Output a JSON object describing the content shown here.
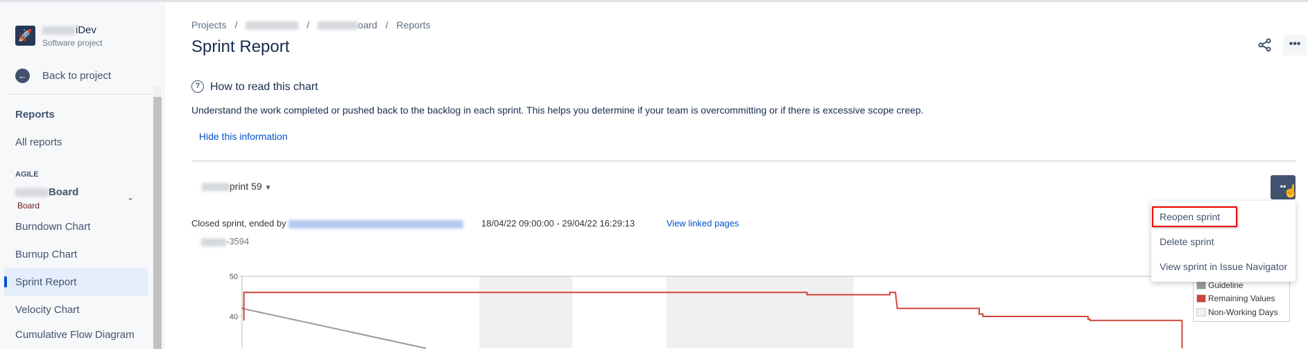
{
  "sidebar": {
    "project_name_suffix": "iDev",
    "project_type": "Software project",
    "back_label": "Back to project",
    "reports_heading": "Reports",
    "all_reports": "All reports",
    "agile_heading": "AGILE",
    "board_name_suffix": "Board",
    "board_type": "Board",
    "items": [
      {
        "label": "Burndown Chart"
      },
      {
        "label": "Burnup Chart"
      },
      {
        "label": "Sprint Report"
      },
      {
        "label": "Velocity Chart"
      },
      {
        "label": "Cumulative Flow Diagram"
      }
    ]
  },
  "breadcrumb": {
    "projects": "Projects",
    "board_suffix": "oard",
    "reports": "Reports",
    "sep": "/"
  },
  "page_title": "Sprint Report",
  "info": {
    "title": "How to read this chart",
    "description": "Understand the work completed or pushed back to the backlog in each sprint. This helps you determine if your team is overcommitting or if there is excessive scope creep.",
    "hide_link": "Hide this information"
  },
  "sprint": {
    "selected_suffix": "print 59",
    "status_prefix": "Closed sprint, ended by",
    "dates": "18/04/22 09:00:00 - 29/04/22 16:29:13",
    "linked_pages": "View linked pages",
    "issue_suffix": "-3594"
  },
  "menu": {
    "items": [
      "Reopen sprint",
      "Delete sprint",
      "View sprint in Issue Navigator"
    ]
  },
  "chart_data": {
    "type": "line",
    "ylim": [
      0,
      50
    ],
    "y_ticks": [
      "50",
      "40"
    ],
    "xlabel": "",
    "ylabel": "",
    "legend": [
      "Guideline",
      "Remaining Values",
      "Non-Working Days"
    ],
    "legend_position": "top-right",
    "colors": {
      "guideline": "#999999",
      "remaining": "#d04437",
      "nonworking": "#f0f0f0"
    },
    "x_unit": "days since sprint start",
    "non_working": [
      [
        2.55,
        3.55
      ],
      [
        4.56,
        6.57
      ]
    ],
    "guideline": [
      [
        0,
        42
      ],
      [
        2.05,
        31.7
      ],
      [
        8.4,
        0
      ]
    ],
    "remaining": [
      [
        0,
        42
      ],
      [
        0.02,
        42
      ],
      [
        0.02,
        39
      ],
      [
        0.02,
        46
      ],
      [
        6.07,
        46
      ],
      [
        6.07,
        45.4
      ],
      [
        6.96,
        45.4
      ],
      [
        6.96,
        46
      ],
      [
        7.02,
        46
      ],
      [
        7.04,
        42
      ],
      [
        7.92,
        42
      ],
      [
        7.92,
        40.6
      ],
      [
        7.96,
        40.6
      ],
      [
        7.96,
        40
      ],
      [
        9.09,
        40
      ],
      [
        9.09,
        39.3
      ],
      [
        9.11,
        39.3
      ],
      [
        9.11,
        39
      ],
      [
        10.1,
        39
      ],
      [
        10.1,
        30
      ]
    ]
  }
}
